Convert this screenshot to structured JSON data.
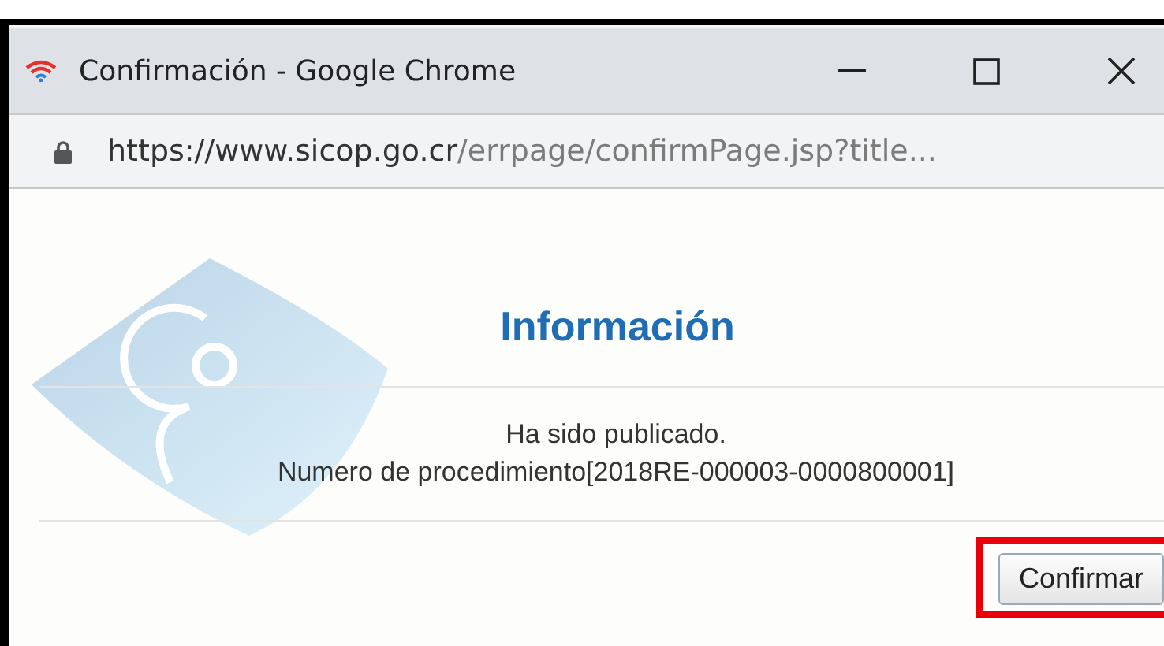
{
  "window": {
    "title": "Confirmación - Google Chrome"
  },
  "address_bar": {
    "secure": true,
    "host": "https://www.sicop.go.cr",
    "path": "/errpage/confirmPage.jsp?title..."
  },
  "dialog": {
    "heading": "Información",
    "message_lines": [
      "Ha sido publicado.",
      "Numero de procedimiento[2018RE-000003-0000800001]"
    ],
    "button": {
      "label": "Confirmar",
      "highlighted": true
    }
  }
}
